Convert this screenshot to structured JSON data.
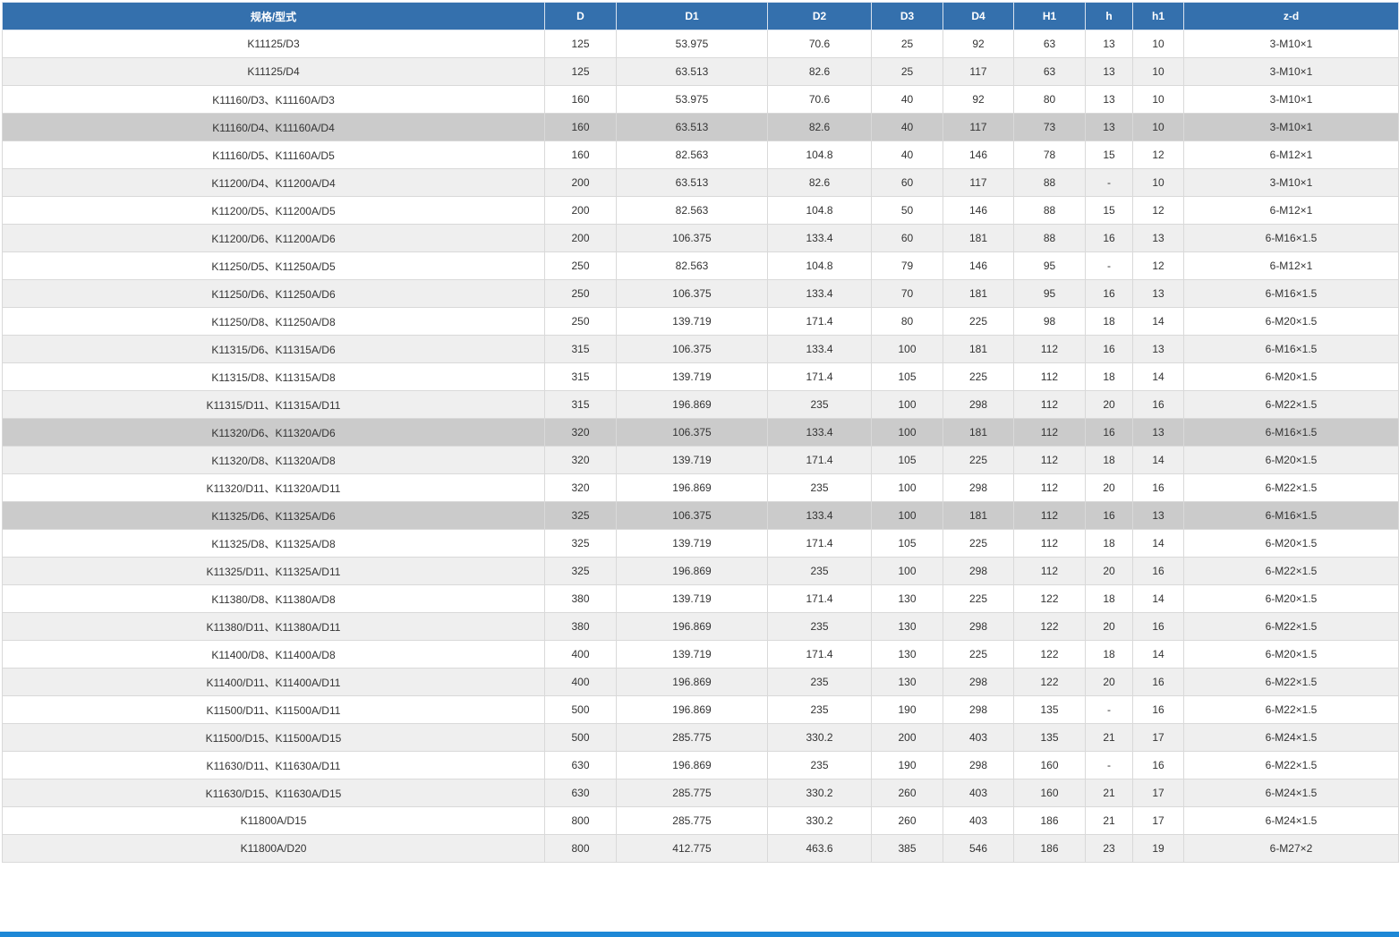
{
  "colors": {
    "header_bg": "#3470ad",
    "row_alt_bg": "#efefef",
    "row_highlight_bg": "#cbcbcb",
    "bottom_bar": "#1e88d6"
  },
  "table": {
    "headers": [
      "规格/型式",
      "D",
      "D1",
      "D2",
      "D3",
      "D4",
      "H1",
      "h",
      "h1",
      "z-d"
    ],
    "highlighted_rows": [
      3,
      14,
      17
    ],
    "rows": [
      [
        "K11125/D3",
        "125",
        "53.975",
        "70.6",
        "25",
        "92",
        "63",
        "13",
        "10",
        "3-M10×1"
      ],
      [
        "K11125/D4",
        "125",
        "63.513",
        "82.6",
        "25",
        "117",
        "63",
        "13",
        "10",
        "3-M10×1"
      ],
      [
        "K11160/D3、K11160A/D3",
        "160",
        "53.975",
        "70.6",
        "40",
        "92",
        "80",
        "13",
        "10",
        "3-M10×1"
      ],
      [
        "K11160/D4、K11160A/D4",
        "160",
        "63.513",
        "82.6",
        "40",
        "117",
        "73",
        "13",
        "10",
        "3-M10×1"
      ],
      [
        "K11160/D5、K11160A/D5",
        "160",
        "82.563",
        "104.8",
        "40",
        "146",
        "78",
        "15",
        "12",
        "6-M12×1"
      ],
      [
        "K11200/D4、K11200A/D4",
        "200",
        "63.513",
        "82.6",
        "60",
        "117",
        "88",
        "-",
        "10",
        "3-M10×1"
      ],
      [
        "K11200/D5、K11200A/D5",
        "200",
        "82.563",
        "104.8",
        "50",
        "146",
        "88",
        "15",
        "12",
        "6-M12×1"
      ],
      [
        "K11200/D6、K11200A/D6",
        "200",
        "106.375",
        "133.4",
        "60",
        "181",
        "88",
        "16",
        "13",
        "6-M16×1.5"
      ],
      [
        "K11250/D5、K11250A/D5",
        "250",
        "82.563",
        "104.8",
        "79",
        "146",
        "95",
        "-",
        "12",
        "6-M12×1"
      ],
      [
        "K11250/D6、K11250A/D6",
        "250",
        "106.375",
        "133.4",
        "70",
        "181",
        "95",
        "16",
        "13",
        "6-M16×1.5"
      ],
      [
        "K11250/D8、K11250A/D8",
        "250",
        "139.719",
        "171.4",
        "80",
        "225",
        "98",
        "18",
        "14",
        "6-M20×1.5"
      ],
      [
        "K11315/D6、K11315A/D6",
        "315",
        "106.375",
        "133.4",
        "100",
        "181",
        "112",
        "16",
        "13",
        "6-M16×1.5"
      ],
      [
        "K11315/D8、K11315A/D8",
        "315",
        "139.719",
        "171.4",
        "105",
        "225",
        "112",
        "18",
        "14",
        "6-M20×1.5"
      ],
      [
        "K11315/D11、K11315A/D11",
        "315",
        "196.869",
        "235",
        "100",
        "298",
        "112",
        "20",
        "16",
        "6-M22×1.5"
      ],
      [
        "K11320/D6、K11320A/D6",
        "320",
        "106.375",
        "133.4",
        "100",
        "181",
        "112",
        "16",
        "13",
        "6-M16×1.5"
      ],
      [
        "K11320/D8、K11320A/D8",
        "320",
        "139.719",
        "171.4",
        "105",
        "225",
        "112",
        "18",
        "14",
        "6-M20×1.5"
      ],
      [
        "K11320/D11、K11320A/D11",
        "320",
        "196.869",
        "235",
        "100",
        "298",
        "112",
        "20",
        "16",
        "6-M22×1.5"
      ],
      [
        "K11325/D6、K11325A/D6",
        "325",
        "106.375",
        "133.4",
        "100",
        "181",
        "112",
        "16",
        "13",
        "6-M16×1.5"
      ],
      [
        "K11325/D8、K11325A/D8",
        "325",
        "139.719",
        "171.4",
        "105",
        "225",
        "112",
        "18",
        "14",
        "6-M20×1.5"
      ],
      [
        "K11325/D11、K11325A/D11",
        "325",
        "196.869",
        "235",
        "100",
        "298",
        "112",
        "20",
        "16",
        "6-M22×1.5"
      ],
      [
        "K11380/D8、K11380A/D8",
        "380",
        "139.719",
        "171.4",
        "130",
        "225",
        "122",
        "18",
        "14",
        "6-M20×1.5"
      ],
      [
        "K11380/D11、K11380A/D11",
        "380",
        "196.869",
        "235",
        "130",
        "298",
        "122",
        "20",
        "16",
        "6-M22×1.5"
      ],
      [
        "K11400/D8、K11400A/D8",
        "400",
        "139.719",
        "171.4",
        "130",
        "225",
        "122",
        "18",
        "14",
        "6-M20×1.5"
      ],
      [
        "K11400/D11、K11400A/D11",
        "400",
        "196.869",
        "235",
        "130",
        "298",
        "122",
        "20",
        "16",
        "6-M22×1.5"
      ],
      [
        "K11500/D11、K11500A/D11",
        "500",
        "196.869",
        "235",
        "190",
        "298",
        "135",
        "-",
        "16",
        "6-M22×1.5"
      ],
      [
        "K11500/D15、K11500A/D15",
        "500",
        "285.775",
        "330.2",
        "200",
        "403",
        "135",
        "21",
        "17",
        "6-M24×1.5"
      ],
      [
        "K11630/D11、K11630A/D11",
        "630",
        "196.869",
        "235",
        "190",
        "298",
        "160",
        "-",
        "16",
        "6-M22×1.5"
      ],
      [
        "K11630/D15、K11630A/D15",
        "630",
        "285.775",
        "330.2",
        "260",
        "403",
        "160",
        "21",
        "17",
        "6-M24×1.5"
      ],
      [
        "K11800A/D15",
        "800",
        "285.775",
        "330.2",
        "260",
        "403",
        "186",
        "21",
        "17",
        "6-M24×1.5"
      ],
      [
        "K11800A/D20",
        "800",
        "412.775",
        "463.6",
        "385",
        "546",
        "186",
        "23",
        "19",
        "6-M27×2"
      ]
    ]
  }
}
